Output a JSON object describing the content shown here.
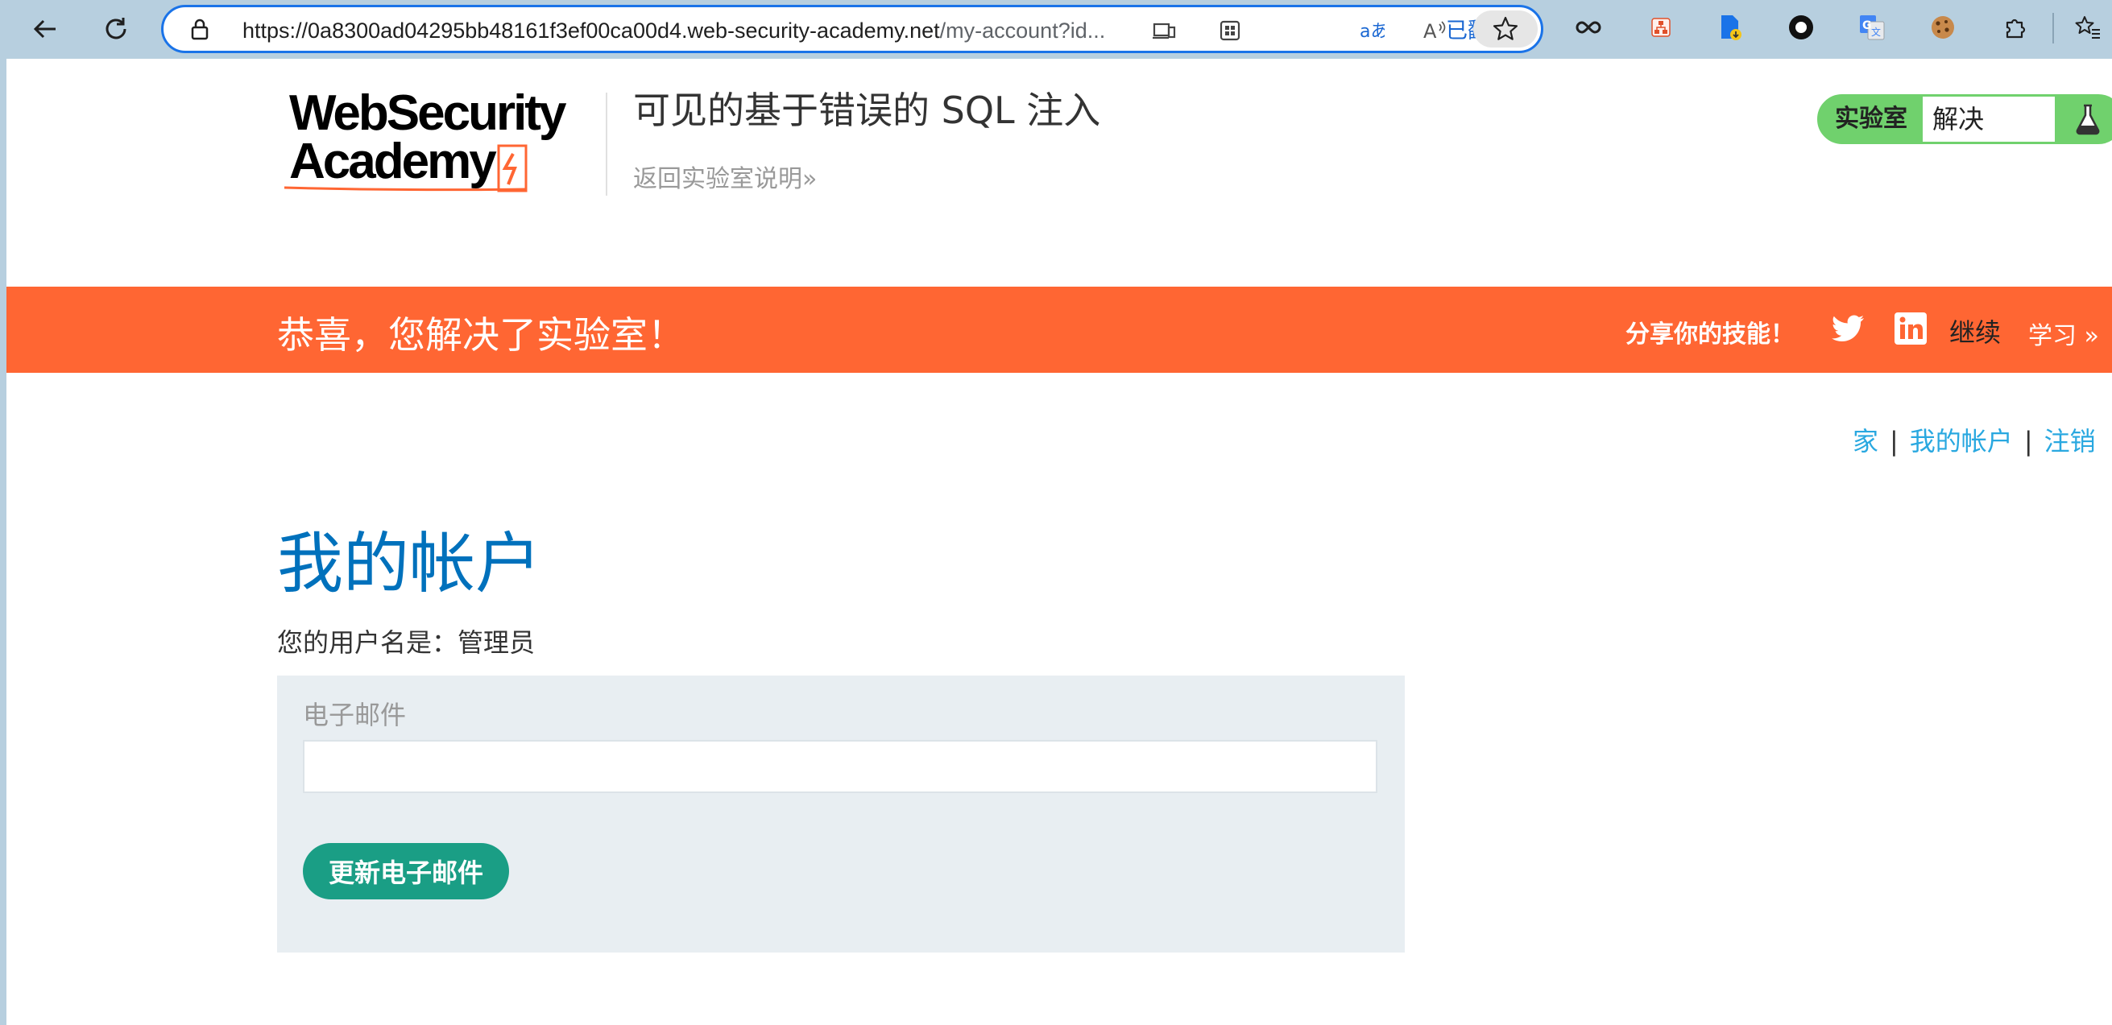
{
  "browser": {
    "url_host": "https://0a8300ad04295bb48161f3ef00ca00d4.web-security-academy.net",
    "url_path": "/my-account?id...",
    "translated_label": "已翻译",
    "accent_color": "#1a73e8"
  },
  "header": {
    "logo_alt": "Web Security Academy",
    "lab_title": "可见的基于错误的 SQL 注入",
    "back_link": "返回实验室说明",
    "lab_status_tag": "实验室",
    "lab_status_value": "解决",
    "status_color": "#70d16d"
  },
  "banner": {
    "message": "恭喜，您解决了实验室！",
    "share": "分享你的技能！",
    "continue": "继续",
    "learn": "学习",
    "color": "#ff6633"
  },
  "nav": {
    "home": "家",
    "sep": "|",
    "account": "我的帐户",
    "logout": "注销"
  },
  "main": {
    "heading": "我的帐户",
    "username_line": "您的用户名是：管理员",
    "email_label": "电子邮件",
    "email_value": "",
    "update_button": "更新电子邮件",
    "button_color": "#1a9e85"
  }
}
